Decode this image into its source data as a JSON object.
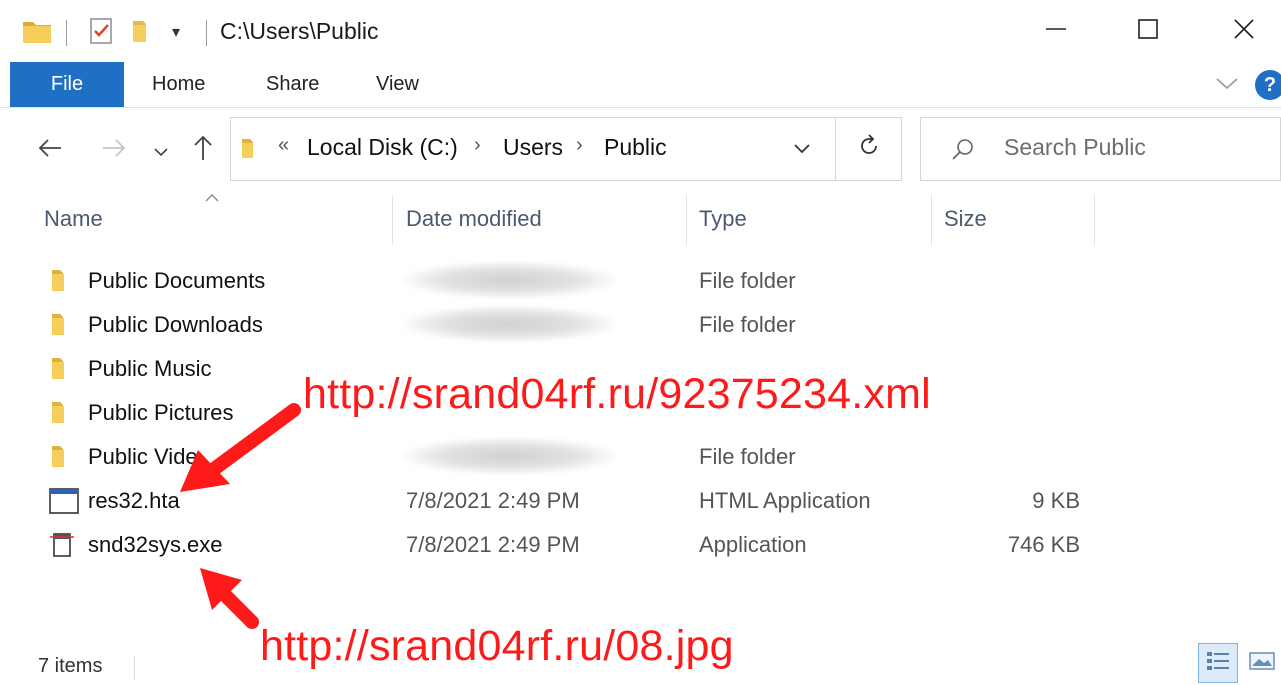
{
  "window": {
    "title": "C:\\Users\\Public",
    "minimize_icon": "minimize-icon",
    "maximize_icon": "maximize-icon",
    "close_icon": "close-icon"
  },
  "ribbon": {
    "tabs": [
      {
        "label": "File"
      },
      {
        "label": "Home"
      },
      {
        "label": "Share"
      },
      {
        "label": "View"
      }
    ]
  },
  "navigation": {
    "breadcrumb_overflow": "«",
    "breadcrumb": [
      "Local Disk (C:)",
      "Users",
      "Public"
    ],
    "search_placeholder": "Search Public"
  },
  "columns": {
    "name": "Name",
    "date_modified": "Date modified",
    "type": "Type",
    "size": "Size"
  },
  "files": [
    {
      "name": "Public Documents",
      "date": "",
      "date_blurred": true,
      "type": "File folder",
      "size": "",
      "icon": "folder-icon"
    },
    {
      "name": "Public Downloads",
      "date": "",
      "date_blurred": true,
      "type": "File folder",
      "size": "",
      "icon": "folder-icon"
    },
    {
      "name": "Public Music",
      "date": "",
      "date_blurred": false,
      "type": "",
      "size": "",
      "icon": "folder-icon"
    },
    {
      "name": "Public Pictures",
      "date": "",
      "date_blurred": false,
      "type": "",
      "size": "",
      "icon": "folder-icon"
    },
    {
      "name": "Public Vide",
      "date": "",
      "date_blurred": true,
      "type": "File folder",
      "size": "",
      "icon": "folder-icon"
    },
    {
      "name": "res32.hta",
      "date": "7/8/2021 2:49 PM",
      "date_blurred": false,
      "type": "HTML Application",
      "size": "9 KB",
      "icon": "hta-file-icon"
    },
    {
      "name": "snd32sys.exe",
      "date": "7/8/2021 2:49 PM",
      "date_blurred": false,
      "type": "Application",
      "size": "746 KB",
      "icon": "exe-file-icon"
    }
  ],
  "status": {
    "item_count": "7 items"
  },
  "annotations": {
    "hta_url": "http://srand04rf.ru/92375234.xml",
    "exe_url": "http://srand04rf.ru/08.jpg",
    "color": "#ff1a1a"
  },
  "colors": {
    "accent": "#1f6fc5",
    "folder": "#f4c542"
  }
}
